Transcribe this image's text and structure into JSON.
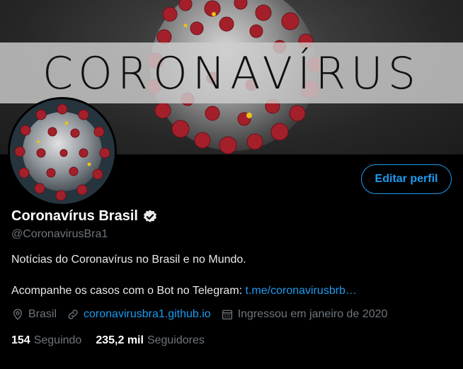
{
  "banner": {
    "title": "CORONAVÍRUS"
  },
  "profile": {
    "name": "Coronavírus Brasil",
    "handle": "@CoronavirusBra1",
    "edit_label": "Editar perfil",
    "bio_line1": "Notícias do Coronavírus no Brasil e no Mundo.",
    "bio_line2_prefix": "Acompanhe os casos com o Bot no Telegram: ",
    "bio_link": "t.me/coronavirusbrb…",
    "location": "Brasil",
    "website": "coronavirusbra1.github.io",
    "joined": "Ingressou em janeiro de 2020"
  },
  "stats": {
    "following_count": "154",
    "following_label": "Seguindo",
    "followers_count": "235,2 mil",
    "followers_label": "Seguidores"
  },
  "colors": {
    "accent": "#1d9bf0",
    "secondary_text": "#6e767d",
    "background": "#000000",
    "virus_red": "#a3202a"
  },
  "icons": {
    "verified": "verified-badge-icon",
    "location": "location-pin-icon",
    "link": "link-icon",
    "calendar": "calendar-icon"
  }
}
